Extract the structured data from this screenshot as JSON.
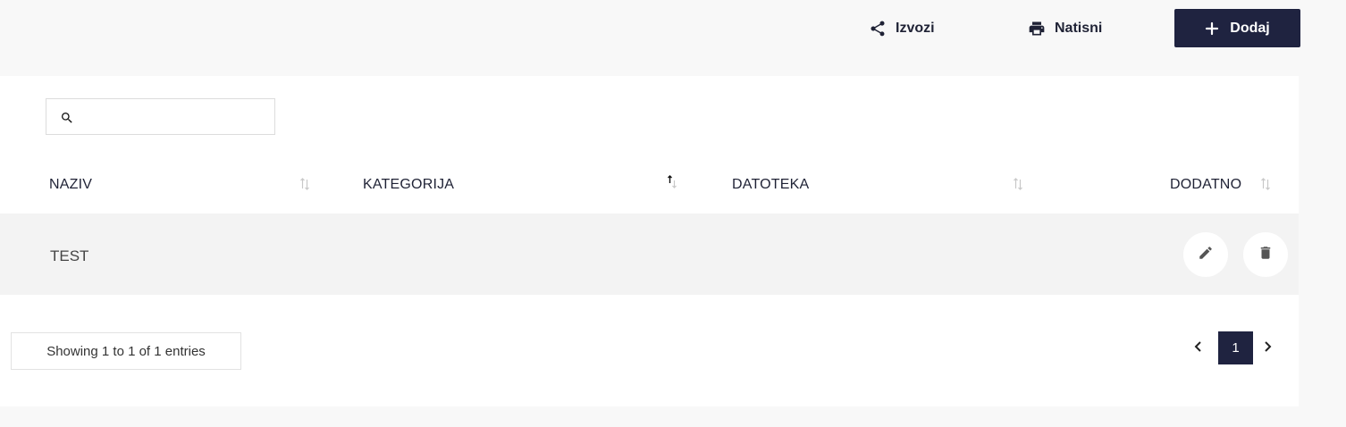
{
  "toolbar": {
    "export_label": "Izvozi",
    "print_label": "Natisni",
    "add_label": "Dodaj"
  },
  "search": {
    "placeholder": "",
    "value": ""
  },
  "table": {
    "columns": [
      "NAZIV",
      "KATEGORIJA",
      "DATOTEKA",
      "DODATNO"
    ],
    "sorted_column": "KATEGORIJA",
    "sort_direction": "ascending",
    "rows": [
      {
        "naziv": "TEST",
        "kategorija": "",
        "datoteka": ""
      }
    ]
  },
  "pagination": {
    "info": "Showing 1 to 1 of 1 entries",
    "current_page": "1"
  },
  "colors": {
    "primary": "#1f2340",
    "row_bg": "#f3f3f3",
    "page_bg": "#f8f8f8"
  },
  "icons": {
    "export": "share-icon",
    "print": "printer-icon",
    "add": "plus-icon",
    "search": "search-icon",
    "edit": "pencil-icon",
    "delete": "trash-icon",
    "prev": "chevron-left-icon",
    "next": "chevron-right-icon"
  }
}
